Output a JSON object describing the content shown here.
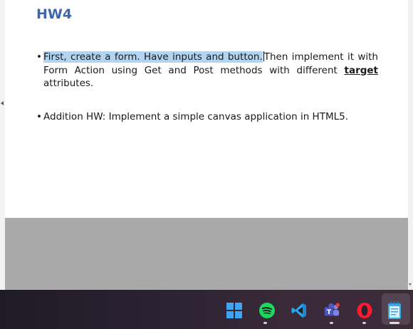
{
  "slide": {
    "title": "HW4",
    "bullet_1": {
      "highlighted": "First, create a form. Have inputs and button.",
      "rest_before_bold": "Then implement it with Form Action using Get and Post methods with different ",
      "bold_word": "target",
      "rest_after_bold": " attributes."
    },
    "bullet_2": {
      "text": "Addition HW: Implement a simple canvas application in HTML5."
    },
    "bullet_symbol": "•"
  },
  "taskbar": {
    "icons": [
      "windows-start-icon",
      "spotify-icon",
      "vscode-icon",
      "teams-icon",
      "opera-icon",
      "notepad-icon"
    ],
    "active": "notepad-icon",
    "colors": {
      "spotify": "#1ed760",
      "vscode": "#23a9f2",
      "teams": "#6264a7",
      "opera": "#ff1b2d",
      "windows": "#3ea4f5"
    }
  }
}
